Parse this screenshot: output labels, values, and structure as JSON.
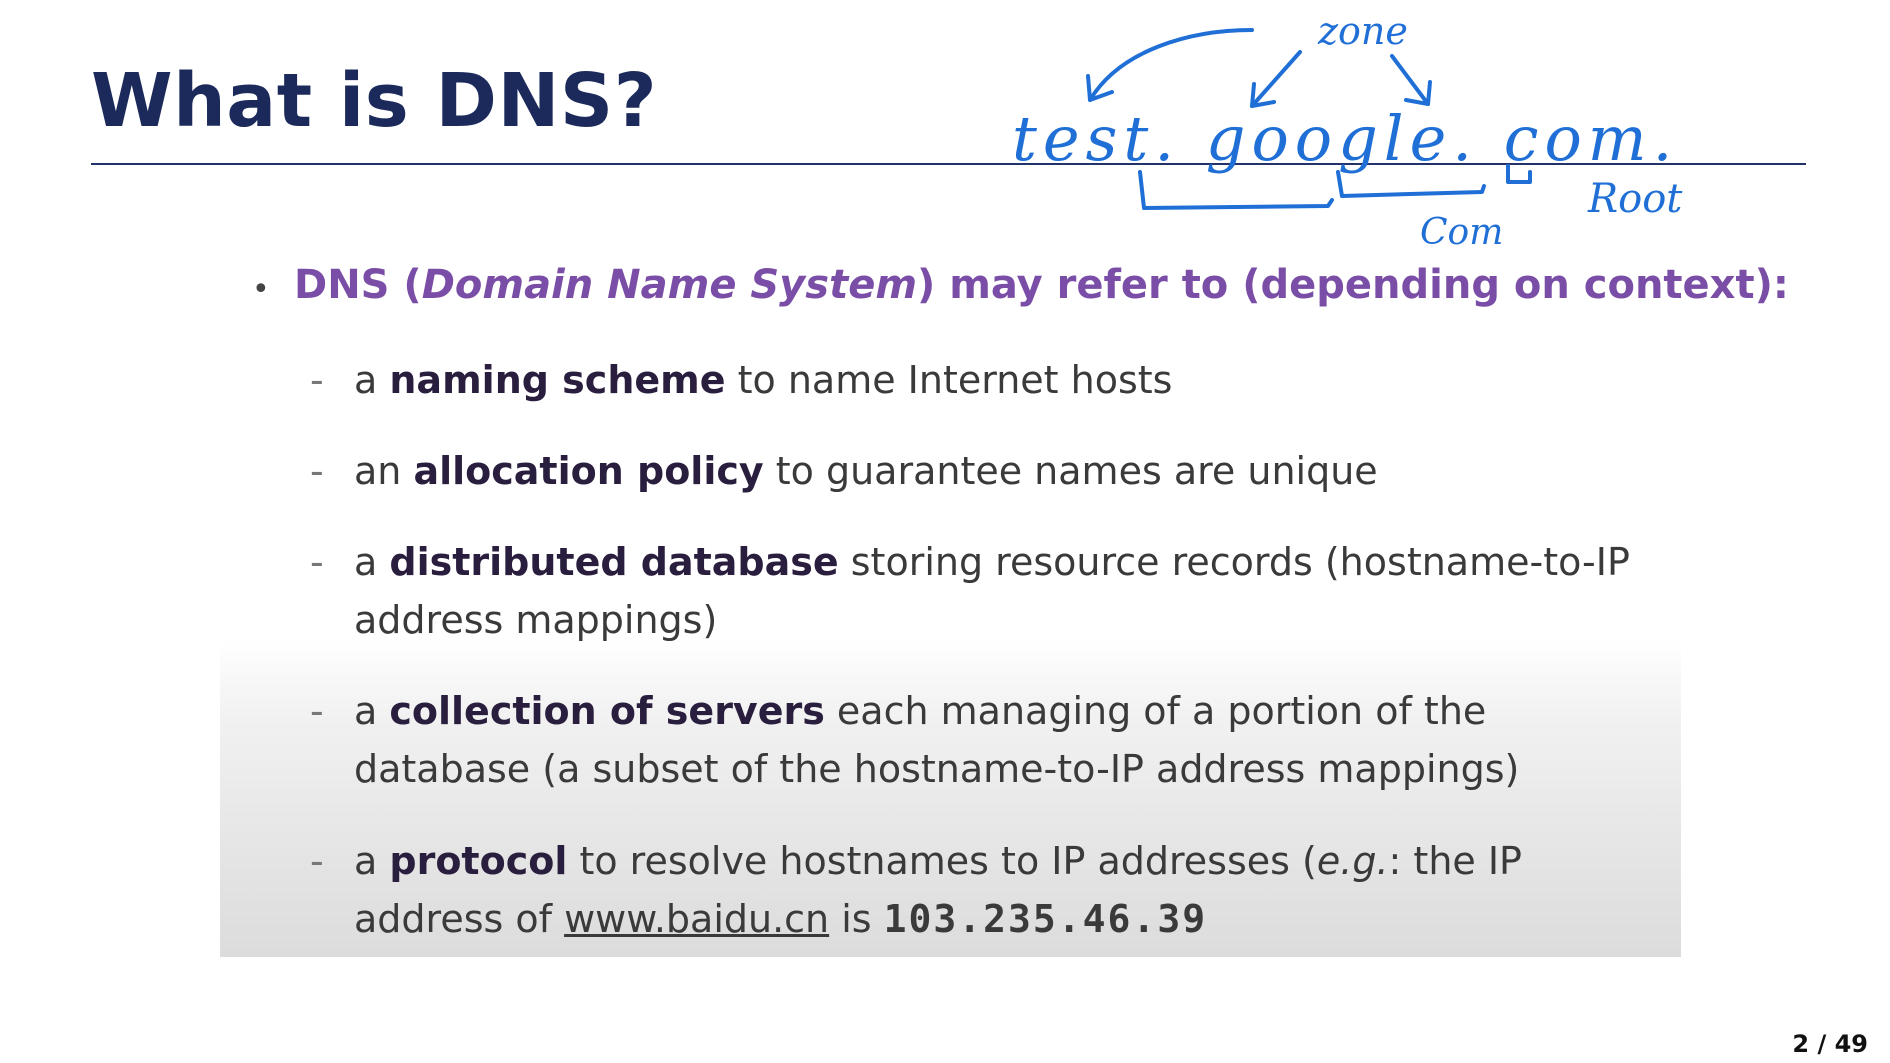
{
  "slide": {
    "title": "What is DNS?",
    "page_number": "2 / 49"
  },
  "annotation": {
    "domain_text": "test. google. com.",
    "zone_label": "zone",
    "com_label": "Com",
    "root_label": "Root",
    "color": "#1f6fd6"
  },
  "content": {
    "main_bullet": {
      "lead": "DNS (",
      "italic": "Domain Name System",
      "rest": ") may refer to (depending on context):"
    },
    "items": [
      {
        "prefix": "a ",
        "bold": "naming scheme",
        "suffix": " to name Internet hosts"
      },
      {
        "prefix": "an ",
        "bold": "allocation policy",
        "suffix": " to guarantee names are unique"
      },
      {
        "prefix": "a ",
        "bold": "distributed database",
        "suffix": " storing resource records  (hostname-to-IP",
        "line2": "address mappings)"
      },
      {
        "prefix": "a ",
        "bold": "collection of servers",
        "suffix": " each managing of a portion of the",
        "line2": "database (a subset of the hostname-to-IP address mappings)"
      },
      {
        "prefix": "a ",
        "bold": "protocol",
        "suffix": " to resolve hostnames to IP addresses (",
        "italic": "e.g.",
        "suffix2": ": the IP",
        "line2_prefix": "address of ",
        "link": "www.baidu.cn",
        "line2_mid": " is ",
        "ip": "103.235.46.39"
      }
    ]
  }
}
